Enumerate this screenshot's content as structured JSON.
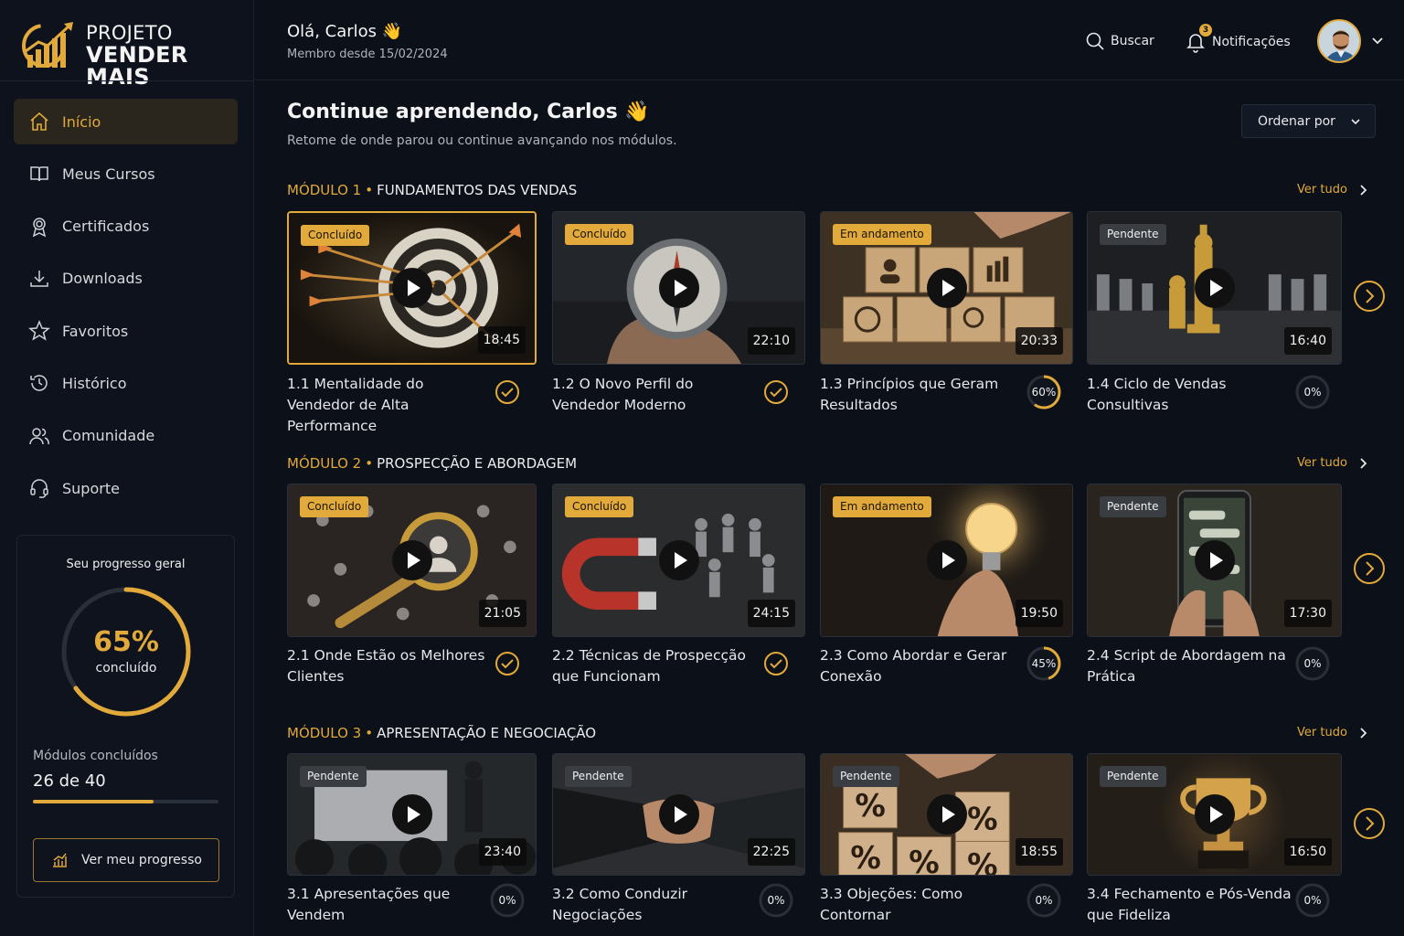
{
  "brand": {
    "line1": "PROJETO",
    "line2": "VENDER MAIS",
    "accent": "#e2a93b"
  },
  "header": {
    "greeting": "Olá, Carlos 👋",
    "member_since": "Membro desde 15/02/2024",
    "search_label": "Buscar",
    "notifications_label": "Notificações",
    "notifications_count": "3"
  },
  "sidebar": {
    "items": [
      {
        "label": "Início",
        "icon": "home-icon",
        "active": true
      },
      {
        "label": "Meus Cursos",
        "icon": "book-icon"
      },
      {
        "label": "Certificados",
        "icon": "certificate-icon"
      },
      {
        "label": "Downloads",
        "icon": "download-icon"
      },
      {
        "label": "Favoritos",
        "icon": "star-icon"
      },
      {
        "label": "Histórico",
        "icon": "history-icon"
      },
      {
        "label": "Comunidade",
        "icon": "users-icon"
      },
      {
        "label": "Suporte",
        "icon": "headset-icon"
      }
    ],
    "progress": {
      "title": "Seu progresso geral",
      "percent_text": "65%",
      "percent_value": 0.65,
      "percent_caption": "concluído",
      "modules_label": "Módulos concluídos",
      "modules_value": "26 de 40",
      "modules_fraction": 0.65,
      "button_label": "Ver meu progresso"
    }
  },
  "main": {
    "title": "Continue aprendendo, Carlos 👋",
    "subtitle": "Retome de onde parou ou continue avançando nos módulos.",
    "sort_label": "Ordenar por",
    "see_all_label": "Ver tudo",
    "modules": [
      {
        "number": "MÓDULO 1",
        "name": "FUNDAMENTOS DAS VENDAS",
        "lessons": [
          {
            "badge": "Concluído",
            "status": "done",
            "duration": "18:45",
            "title": "1.1 Mentalidade do Vendedor de Alta Performance",
            "progress": "",
            "image": "target-arrows"
          },
          {
            "badge": "Concluído",
            "status": "done",
            "duration": "22:10",
            "title": "1.2 O Novo Perfil do Vendedor Moderno",
            "progress": "",
            "image": "compass"
          },
          {
            "badge": "Em andamento",
            "status": "progress",
            "duration": "20:33",
            "title": "1.3 Princípios que Geram Resultados",
            "progress": "60%",
            "progress_value": 0.6,
            "image": "wooden-blocks"
          },
          {
            "badge": "Pendente",
            "status": "pending",
            "duration": "16:40",
            "title": "1.4 Ciclo de Vendas Consultivas",
            "progress": "0%",
            "progress_value": 0,
            "image": "chess"
          }
        ]
      },
      {
        "number": "MÓDULO 2",
        "name": "PROSPECÇÃO E ABORDAGEM",
        "lessons": [
          {
            "badge": "Concluído",
            "status": "done",
            "duration": "21:05",
            "title": "2.1 Onde Estão os Melhores Clientes",
            "progress": "",
            "image": "magnifier-people"
          },
          {
            "badge": "Concluído",
            "status": "done",
            "duration": "24:15",
            "title": "2.2 Técnicas de Prospecção que Funcionam",
            "progress": "",
            "image": "magnet"
          },
          {
            "badge": "Em andamento",
            "status": "progress",
            "duration": "19:50",
            "title": "2.3 Como Abordar e Gerar Conexão",
            "progress": "45%",
            "progress_value": 0.45,
            "image": "lightbulb"
          },
          {
            "badge": "Pendente",
            "status": "pending",
            "duration": "17:30",
            "title": "2.4 Script de Abordagem na Prática",
            "progress": "0%",
            "progress_value": 0,
            "image": "phone-chat"
          }
        ]
      },
      {
        "number": "MÓDULO 3",
        "name": "APRESENTAÇÃO E NEGOCIAÇÃO",
        "lessons": [
          {
            "badge": "Pendente",
            "status": "pending",
            "duration": "23:40",
            "title": "3.1 Apresentações que Vendem",
            "progress": "0%",
            "progress_value": 0,
            "image": "presentation"
          },
          {
            "badge": "Pendente",
            "status": "pending",
            "duration": "22:25",
            "title": "3.2 Como Conduzir Negociações",
            "progress": "0%",
            "progress_value": 0,
            "image": "handshake"
          },
          {
            "badge": "Pendente",
            "status": "pending",
            "duration": "18:55",
            "title": "3.3 Objeções: Como Contornar",
            "progress": "0%",
            "progress_value": 0,
            "image": "percent-blocks"
          },
          {
            "badge": "Pendente",
            "status": "pending",
            "duration": "16:50",
            "title": "3.4 Fechamento e Pós-Venda que Fideliza",
            "progress": "0%",
            "progress_value": 0,
            "image": "trophy"
          }
        ]
      }
    ]
  }
}
